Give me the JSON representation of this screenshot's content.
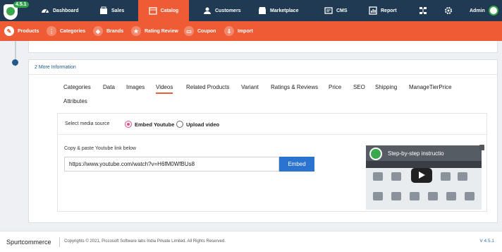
{
  "app": {
    "version_badge": "4.5.1",
    "admin_label": "Admin"
  },
  "topnav": {
    "items": [
      {
        "label": "Dashboard",
        "icon": "dashboard-icon"
      },
      {
        "label": "Sales",
        "icon": "sales-icon"
      },
      {
        "label": "Catalog",
        "icon": "catalog-icon"
      },
      {
        "label": "Customers",
        "icon": "customers-icon"
      },
      {
        "label": "Marketplace",
        "icon": "marketplace-icon"
      },
      {
        "label": "CMS",
        "icon": "cms-icon"
      },
      {
        "label": "Report",
        "icon": "report-icon"
      }
    ]
  },
  "subnav": {
    "items": [
      {
        "label": "Products"
      },
      {
        "label": "Categories"
      },
      {
        "label": "Brands"
      },
      {
        "label": "Rating Review"
      },
      {
        "label": "Coupon"
      },
      {
        "label": "Import"
      }
    ]
  },
  "section": {
    "title": "2 More Information"
  },
  "tabs": [
    "Categories",
    "Data",
    "Images",
    "Videos",
    "Related Products",
    "Variant",
    "Ratings & Reviews",
    "Price",
    "SEO",
    "Shipping",
    "ManageTierPrice",
    "Attributes"
  ],
  "media": {
    "label": "Select media source",
    "option_youtube": "Embed Youtube",
    "option_upload": "Upload video",
    "link_label": "Copy & paste Youtube link below",
    "url_value": "https://www.youtube.com/watch?v=H6fM0WfBUs8",
    "embed_button": "Embed",
    "video_title": "Step-by-step instructio"
  },
  "footer": {
    "brand": "Spurtcommerce",
    "copyright": "Copyrights © 2021, Piccosoft Software labs India Private Limited. All Rights Reserved.",
    "version": "V 4.5.1"
  },
  "colors": {
    "topbar": "#1f3a52",
    "accent": "#ef5b35",
    "primary_button": "#2a73cf"
  }
}
